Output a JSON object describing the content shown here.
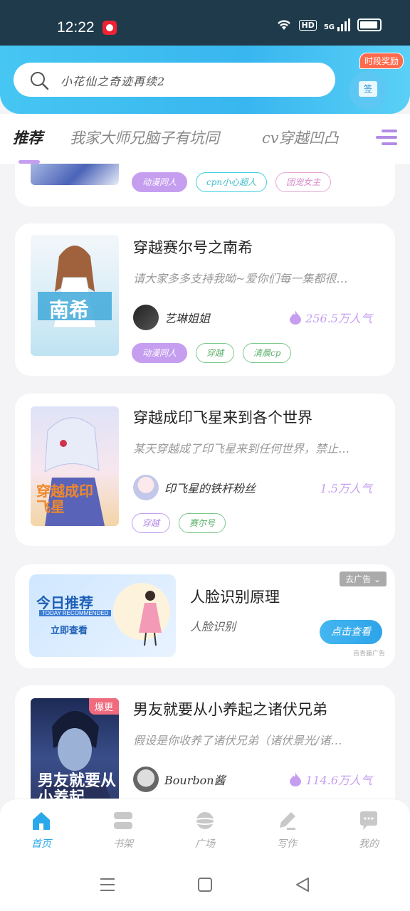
{
  "status_bar": {
    "time": "12:22",
    "network": "5G",
    "hd": "HD"
  },
  "header": {
    "search_placeholder": "小花仙之奇迹再续2",
    "sign_bonus": "时段奖励",
    "sign_label": "签"
  },
  "tabs": {
    "items": [
      "推荐",
      "我家大师兄脑子有坑同",
      "cv穿越凹凸"
    ]
  },
  "cards": [
    {
      "tags": [
        "动漫同人",
        "cpn小心超人",
        "团宠女主"
      ]
    },
    {
      "title": "穿越赛尔号之南希",
      "desc": "请大家多多支持我呦~爱你们每一集都很…",
      "author": "艺琳姐姐",
      "popularity": "256.5万人气",
      "tags": [
        "动漫同人",
        "穿越",
        "清晨cp"
      ],
      "cover_text": "南希"
    },
    {
      "title": "穿越成印飞星来到各个世界",
      "desc": "某天穿越成了印飞星来到任何世界，禁止…",
      "author": "印飞星的铁杆粉丝",
      "popularity": "1.5万人气",
      "tags": [
        "穿越",
        "赛尔号"
      ],
      "cover_text": "穿越成印飞星"
    },
    {
      "title": "男友就要从小养起之诸伏兄弟",
      "desc": "假设是你收养了诸伏兄弟（诸伏景光/诸…",
      "author": "Bourbon酱",
      "popularity": "114.6万人气",
      "badge": "爆更",
      "cover_text": "男友就要从小养起"
    }
  ],
  "ad": {
    "banner_title": "今日推荐",
    "banner_sub": "TODAY RECOMMENDED",
    "banner_cta": "立即查看",
    "title": "人脸识别原理",
    "subtitle": "人脸识别",
    "close_label": "去广告",
    "button": "点击查看",
    "note": "百青藤广告"
  },
  "bottom_nav": {
    "items": [
      "首页",
      "书架",
      "广场",
      "写作",
      "我的"
    ],
    "active": "首页"
  },
  "colors": {
    "accent": "#2aa8ec",
    "tag_purple": "#c59ef0",
    "header": "#38b6ef"
  }
}
